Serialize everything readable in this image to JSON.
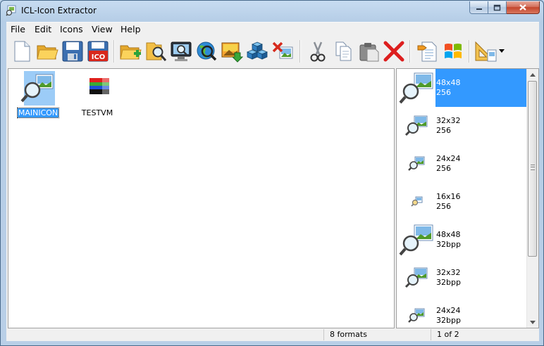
{
  "window": {
    "title": "ICL-Icon Extractor"
  },
  "menu": [
    "File",
    "Edit",
    "Icons",
    "View",
    "Help"
  ],
  "toolbar": {
    "buttons": [
      {
        "name": "new-file",
        "icon": "new-document-icon"
      },
      {
        "name": "open-folder",
        "icon": "open-folder-icon"
      },
      {
        "name": "save",
        "icon": "floppy-disk-icon"
      },
      {
        "name": "save-ico",
        "icon": "save-ico-icon",
        "badge": "ICO"
      },
      {
        "name": "add-folder",
        "icon": "folder-add-icon"
      },
      {
        "name": "browse-folder",
        "icon": "folder-search-icon"
      },
      {
        "name": "search-computer",
        "icon": "monitor-search-icon"
      },
      {
        "name": "search-web",
        "icon": "globe-search-icon"
      },
      {
        "name": "import-image",
        "icon": "image-import-icon"
      },
      {
        "name": "extract-resources",
        "icon": "cubes-icon"
      },
      {
        "name": "remove-image",
        "icon": "image-remove-icon"
      },
      {
        "name": "cut",
        "icon": "scissors-icon"
      },
      {
        "name": "copy",
        "icon": "copy-icon"
      },
      {
        "name": "paste",
        "icon": "paste-icon"
      },
      {
        "name": "delete",
        "icon": "red-x-icon"
      },
      {
        "name": "properties",
        "icon": "properties-icon"
      },
      {
        "name": "windows",
        "icon": "windows-logo-icon"
      },
      {
        "name": "tools",
        "icon": "set-square-icon"
      }
    ]
  },
  "icons": [
    {
      "label": "MAINICON",
      "selected": true
    },
    {
      "label": "TESTVM",
      "selected": false
    }
  ],
  "formats": [
    {
      "size": "48x48",
      "depth": "256",
      "selected": true
    },
    {
      "size": "32x32",
      "depth": "256",
      "selected": false
    },
    {
      "size": "24x24",
      "depth": "256",
      "selected": false
    },
    {
      "size": "16x16",
      "depth": "256",
      "selected": false
    },
    {
      "size": "48x48",
      "depth": "32bpp",
      "selected": false
    },
    {
      "size": "32x32",
      "depth": "32bpp",
      "selected": false
    },
    {
      "size": "24x24",
      "depth": "32bpp",
      "selected": false
    }
  ],
  "status": {
    "formats": "8 formats",
    "page": "1 of 2"
  },
  "colors": {
    "selection": "#3399ff",
    "close": "#c4452c"
  }
}
